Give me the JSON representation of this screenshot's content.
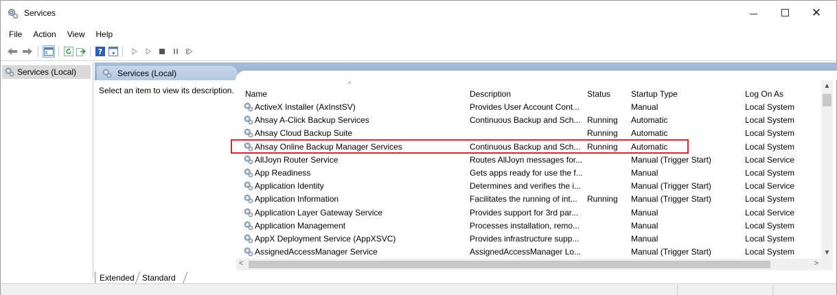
{
  "window": {
    "title": "Services",
    "minimize": "–",
    "maximize": "□",
    "close": "✕"
  },
  "menu": [
    "File",
    "Action",
    "View",
    "Help"
  ],
  "toolbar": {
    "icons": [
      "back-arrow-icon",
      "forward-arrow-icon",
      "console-tree-icon",
      "refresh-icon",
      "export-list-icon",
      "help-icon",
      "properties-icon",
      "start-service-icon",
      "start-service-alt-icon",
      "stop-service-icon",
      "pause-service-icon",
      "resume-service-icon"
    ]
  },
  "tree": {
    "selected_item": "Services (Local)"
  },
  "pane": {
    "header_title": "Services (Local)",
    "description_prompt": "Select an item to view its description."
  },
  "columns": {
    "name": "Name",
    "description": "Description",
    "status": "Status",
    "startup_type": "Startup Type",
    "log_on_as": "Log On As"
  },
  "services": [
    {
      "name": "ActiveX Installer (AxInstSV)",
      "description": "Provides User Account Cont...",
      "status": "",
      "startup": "Manual",
      "logon": "Local System"
    },
    {
      "name": "Ahsay A-Click Backup Services",
      "description": "Continuous Backup and Sch...",
      "status": "Running",
      "startup": "Automatic",
      "logon": "Local System"
    },
    {
      "name": "Ahsay Cloud Backup Suite",
      "description": "",
      "status": "Running",
      "startup": "Automatic",
      "logon": "Local System"
    },
    {
      "name": "Ahsay Online Backup Manager Services",
      "description": "Continuous Backup and Sch...",
      "status": "Running",
      "startup": "Automatic",
      "logon": "Local System"
    },
    {
      "name": "AllJoyn Router Service",
      "description": "Routes AllJoyn messages for...",
      "status": "",
      "startup": "Manual (Trigger Start)",
      "logon": "Local Service"
    },
    {
      "name": "App Readiness",
      "description": "Gets apps ready for use the f...",
      "status": "",
      "startup": "Manual",
      "logon": "Local System"
    },
    {
      "name": "Application Identity",
      "description": "Determines and verifies the i...",
      "status": "",
      "startup": "Manual (Trigger Start)",
      "logon": "Local Service"
    },
    {
      "name": "Application Information",
      "description": "Facilitates the running of int...",
      "status": "Running",
      "startup": "Manual (Trigger Start)",
      "logon": "Local System"
    },
    {
      "name": "Application Layer Gateway Service",
      "description": "Provides support for 3rd par...",
      "status": "",
      "startup": "Manual",
      "logon": "Local Service"
    },
    {
      "name": "Application Management",
      "description": "Processes installation, remo...",
      "status": "",
      "startup": "Manual",
      "logon": "Local System"
    },
    {
      "name": "AppX Deployment Service (AppXSVC)",
      "description": "Provides infrastructure supp...",
      "status": "",
      "startup": "Manual",
      "logon": "Local System"
    },
    {
      "name": "AssignedAccessManager Service",
      "description": "AssignedAccessManager Lo...",
      "status": "",
      "startup": "Manual (Trigger Start)",
      "logon": "Local System"
    }
  ],
  "highlighted_row": "Ahsay Online Backup Manager Services",
  "highlight_color": "#e0202b",
  "header_color": "#a9bfd9",
  "tabs": [
    "Extended",
    "Standard"
  ]
}
